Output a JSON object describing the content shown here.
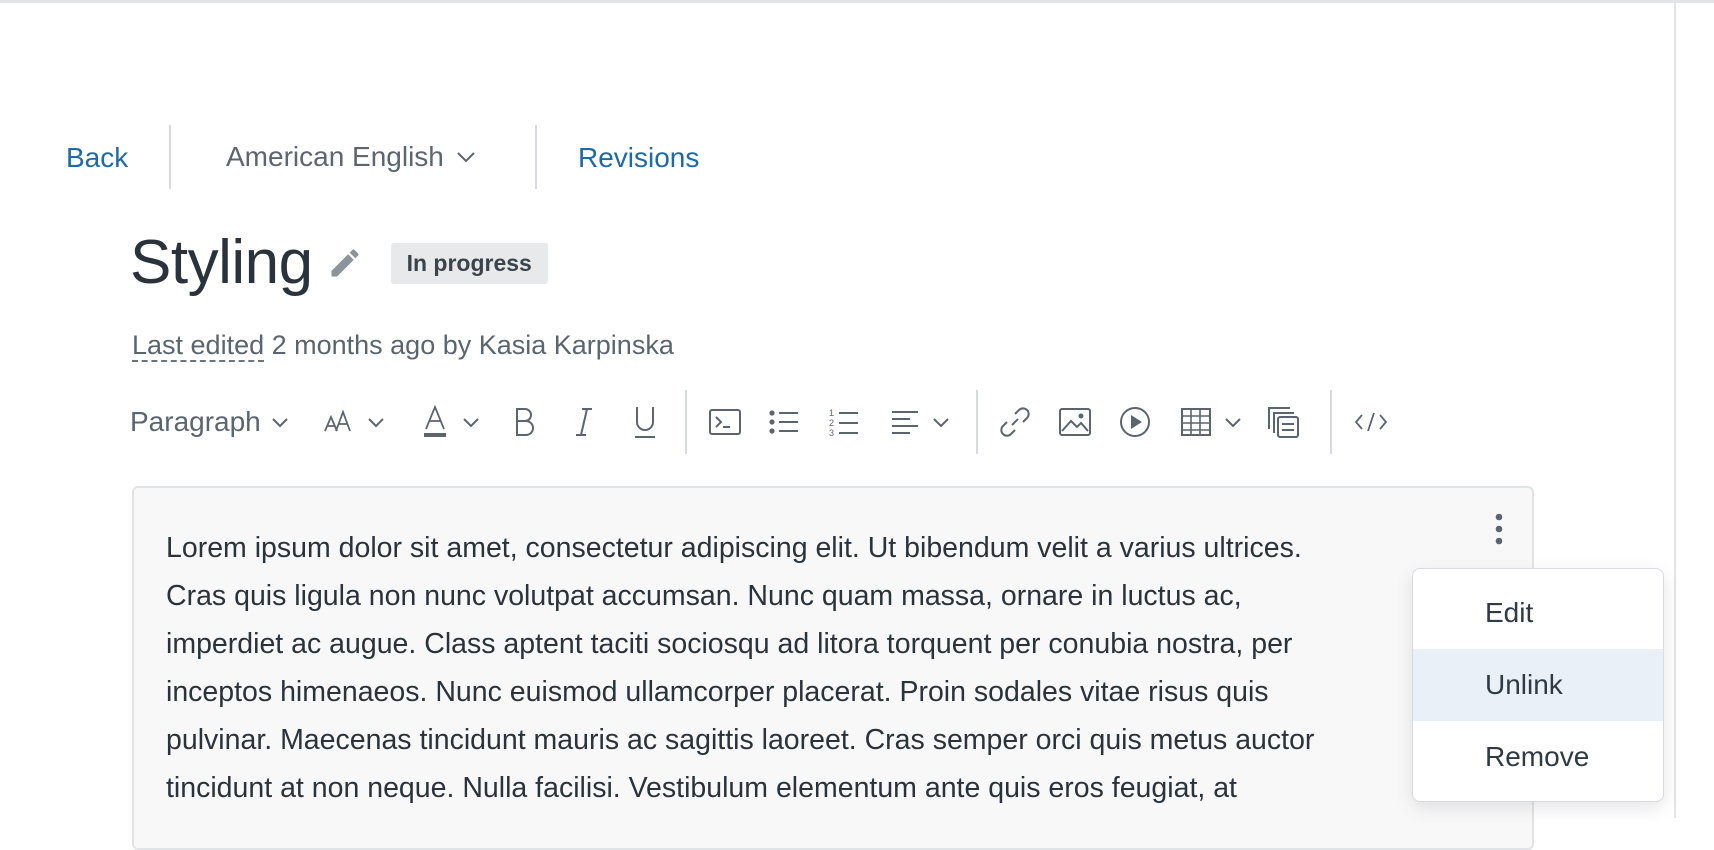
{
  "nav": {
    "back_label": "Back",
    "language_label": "American English",
    "revisions_label": "Revisions"
  },
  "page": {
    "title": "Styling",
    "status_badge": "In progress",
    "meta_prefix": "Last edited",
    "meta_rest": " 2 months ago by Kasia Karpinska"
  },
  "toolbar": {
    "block_format": "Paragraph",
    "buttons": [
      "font-size-icon",
      "font-color-icon",
      "bold-icon",
      "italic-icon",
      "underline-icon",
      "code-block-icon",
      "bulleted-list-icon",
      "numbered-list-icon",
      "align-icon",
      "link-icon",
      "image-icon",
      "media-icon",
      "table-icon",
      "snippet-icon",
      "source-code-icon"
    ]
  },
  "editor": {
    "body_lines": [
      "Lorem ipsum dolor sit amet, consectetur adipiscing elit. Ut bibendum velit a varius ultrices.",
      "Cras quis ligula non nunc volutpat accumsan. Nunc quam massa, ornare in luctus ac,",
      "imperdiet ac augue. Class aptent taciti sociosqu ad litora torquent per conubia nostra, per",
      "inceptos himenaeos. Nunc euismod ullamcorper placerat. Proin sodales vitae risus quis",
      "pulvinar. Maecenas tincidunt mauris ac sagittis laoreet. Cras semper orci quis metus auctor",
      "tincidunt at non neque. Nulla facilisi. Vestibulum elementum ante quis eros feugiat, at"
    ]
  },
  "context_menu": {
    "items": [
      "Edit",
      "Unlink",
      "Remove"
    ],
    "highlighted": "Unlink"
  },
  "colors": {
    "link": "#1f6aa6",
    "text": "#2a333c",
    "muted": "#5b6570",
    "menu_highlight": "#eaf0f8"
  }
}
